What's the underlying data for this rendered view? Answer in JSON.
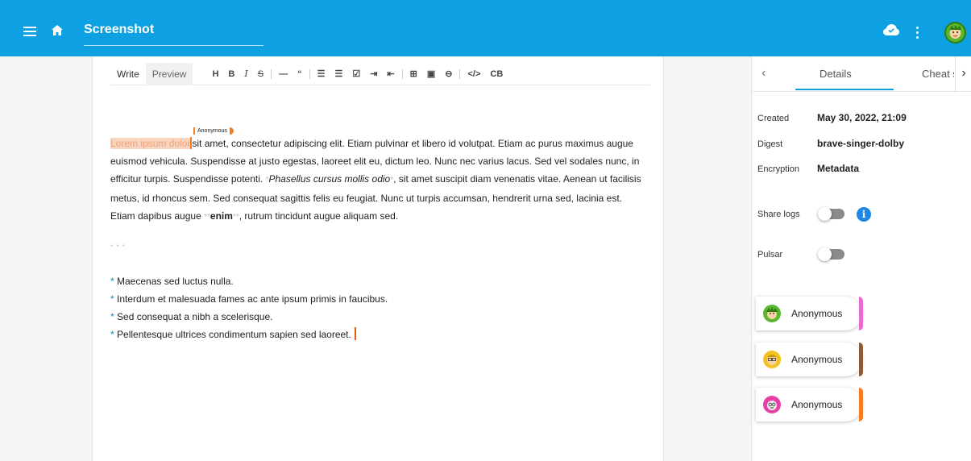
{
  "app": {
    "title": "Screenshot"
  },
  "icons": {
    "menu": "menu-icon",
    "home": "home-icon",
    "cloud": "cloud-done-icon",
    "more": "more-vert-icon",
    "avatar": "user-avatar"
  },
  "editor": {
    "tabs": {
      "write": "Write",
      "preview": "Preview"
    },
    "toolbar": [
      "H",
      "B",
      "I",
      "S",
      "—",
      "“",
      "☰",
      "☰",
      "☑",
      "⇥",
      "⇤",
      "⊞",
      "▣",
      "⊖",
      "</>",
      "CB"
    ],
    "cursor_label": "Anonymous",
    "para_highlight": "Lorem ipsum dolor",
    "para_1": "sit amet, consectetur adipiscing elit. Etiam pulvinar et libero id volutpat. Etiam ac purus maximus augue euismod vehicula. Suspendisse at justo egestas, laoreet elit eu, dictum leo. Nunc nec varius lacus. Sed vel sodales nunc, in efficitur turpis. Suspendisse potenti. ",
    "italic_mark": "*",
    "italic_text": "Phasellus cursus mollis odio",
    "para_2": ", sit amet suscipit diam venenatis vitae. Aenean ut facilisis metus, id rhoncus sem. Sed consequat sagittis felis eu feugiat. Nunc ut turpis accumsan, hendrerit urna sed, lacinia est. Etiam dapibus augue ",
    "bold_mark": "**",
    "bold_text": "enim",
    "para_3": ", rutrum tincidunt augue aliquam sed.",
    "hr": "* * *",
    "list_marker": "*",
    "list": [
      "Maecenas sed luctus nulla.",
      "Interdum et malesuada fames ac ante ipsum primis in faucibus.",
      "Sed consequat a nibh a scelerisque.",
      " Pellentesque ultrices condimentum sapien sed laoreet."
    ]
  },
  "panel": {
    "tab_details": "Details",
    "tab_cheat": "Cheat s",
    "created_label": "Created",
    "created_value": "May 30, 2022, 21:09",
    "digest_label": "Digest",
    "digest_value": "brave-singer-dolby",
    "encryption_label": "Encryption",
    "encryption_value": "Metadata",
    "share_logs_label": "Share logs",
    "share_logs_on": false,
    "pulsar_label": "Pulsar",
    "pulsar_on": false,
    "info_glyph": "i",
    "users": [
      {
        "name": "Anonymous",
        "accent": "#e86cd0",
        "avatar_color": "#5bb62f"
      },
      {
        "name": "Anonymous",
        "accent": "#8d5a3b",
        "avatar_color": "#f3c21f"
      },
      {
        "name": "Anonymous",
        "accent": "#f57c20",
        "avatar_color": "#e83fa6"
      }
    ]
  },
  "colors": {
    "appbar": "#0da1e4",
    "cursor": "#f57c20"
  }
}
